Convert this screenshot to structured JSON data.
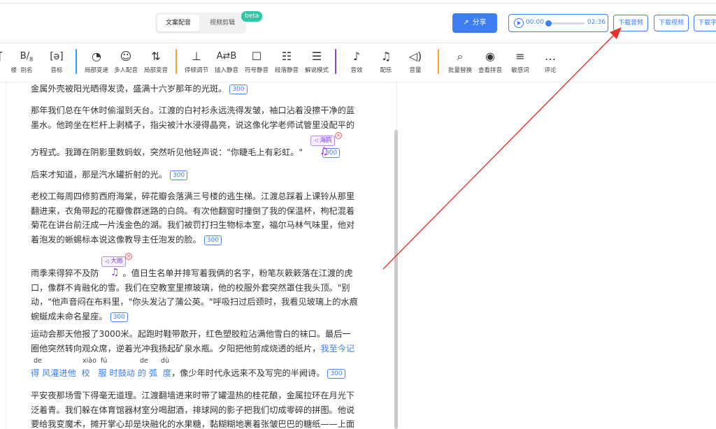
{
  "header": {
    "tabs": [
      {
        "label": "文案配音"
      },
      {
        "label": "视频剪辑"
      }
    ],
    "beta_badge": "beta",
    "share_label": "分享",
    "player": {
      "current_time": "00:00",
      "total_time": "02:36",
      "progress": 0.0
    },
    "download_audio": "下载音频",
    "download_video": "下载视频",
    "download_subtitle": "下载字"
  },
  "toolbar": {
    "items": [
      {
        "label": "楼",
        "icon": "multi-voice-icon"
      },
      {
        "label": "别名",
        "icon": "alias-icon"
      },
      {
        "label": "音标",
        "icon": "phonetic-icon"
      },
      {
        "label": "局部变速",
        "icon": "speed-dial-icon"
      },
      {
        "label": "多人配音",
        "icon": "multi-speaker-icon"
      },
      {
        "label": "局部变音",
        "icon": "voice-change-icon"
      },
      {
        "label": "停顿调节",
        "icon": "pause-adjust-icon"
      },
      {
        "label": "插入静音",
        "icon": "insert-silence-icon"
      },
      {
        "label": "符号静音",
        "icon": "symbol-silence-icon"
      },
      {
        "label": "段落静音",
        "icon": "paragraph-silence-icon"
      },
      {
        "label": "解说模式",
        "icon": "narration-mode-icon"
      },
      {
        "label": "音效",
        "icon": "sound-effect-icon"
      },
      {
        "label": "配乐",
        "icon": "music-icon"
      },
      {
        "label": "音量",
        "icon": "volume-icon"
      },
      {
        "label": "批量替换",
        "icon": "search-icon"
      },
      {
        "label": "查看拼音",
        "icon": "eye-icon"
      },
      {
        "label": "敏感词",
        "icon": "sensitive-word-icon"
      },
      {
        "label": "评论",
        "icon": "comment-icon"
      }
    ],
    "separator_colors": [
      "#2f9ff0",
      "#f4a23b",
      "#8e44d6",
      "#f4a23b"
    ]
  },
  "editor": {
    "count_badge": "300",
    "p1": "金属外壳被阳光晒得发烫，盛满十六岁那年的光斑。",
    "p2_line1": "那年我们总在午休时偷溜到天台。江渡的白衬衫永远洗得发皱，袖口沾着没擦干净的蓝",
    "p2_line2": "墨水。他跨坐在栏杆上剥橘子，指尖被汁水浸得晶亮，说这像化学老师试管里没配平的",
    "p2_line3": "方程式。我蹲在阴影里数蚂蚁，突然听见他轻声说：\"你睫毛上有彩虹。\"",
    "tag1": "海鸥",
    "p3": "后来才知道，那是汽水罐折射的光。",
    "p4_line1": "老校工每周四修剪西府海棠，碎花瓣会落满三号楼的逃生梯。江渡总踩着上课铃从那里",
    "p4_line2": "翻进来，衣角带起的花瓣像群迷路的白鸽。有次他翻窗时撞倒了我的保温杯，枸杞混着",
    "p4_line3": "菊花在讲台前汪成一片浅金色的湖。我们被罚打扫生物标本室，福尔马林气味里，他对",
    "p4_line4": "着泡发的蜥蜴标本说这像教导主任泡发的脸。",
    "tag2": "大雨",
    "p5_line1a": "雨季来得猝不及防",
    "p5_line1b": "。值日生名单并排写着我俩的名字，粉笔灰簌簌落在江渡的虎",
    "p5_line2": "口，像群不肯融化的雪。我们在空教室里擦玻璃，他的校服外套突然罩住我头顶。\"别",
    "p5_line3": "动，\"他声音闷在布料里，\"你头发沾了蒲公英。\"呼吸扫过后颈时，我看见玻璃上的水痕",
    "p5_line4": "蜿蜒成未命名星座。",
    "p6_line1": "运动会那天他报了3000米。起跑时鞋带散开，红色塑胶粒沾满他雪白的袜口。最后一",
    "p6_line2a": "圈他突然转向观众席，逆着光冲我扬起矿泉水瓶。夕阳把他剪成烧透的纸片，",
    "p6_line2b": "我至今记",
    "p6_line3a": "得 风灌进他  校   服 时鼓动 的 弧  度",
    "p6_line3b": "，像少年时代永远来不及写完的半阙诗。",
    "pinyin": [
      "de",
      "xiào",
      "fú",
      "de",
      "dù"
    ],
    "p7_line1": "平安夜那场雪下得毫无道理。江渡翻墙进来时带了罐温热的桂花酿，金属拉环在月光下",
    "p7_line2": "泛着青。我们躲在体育馆器材室分喝甜酒，排球网的影子把我们切成零碎的拼图。他说",
    "p7_line3": "要给我变魔术，摊开掌心却是块融化的水果糖，黏糊糊地裹着张皱巴巴的糖纸——上面"
  },
  "colors": {
    "accent": "#3d7ef5",
    "annotation": "#8b3ee0",
    "arrow": "#e8312a",
    "beta": "#2ec7a7"
  }
}
